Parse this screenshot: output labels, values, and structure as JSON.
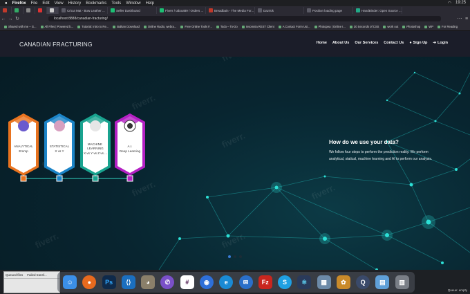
{
  "menubar": {
    "items": [
      "Firefox",
      "File",
      "Edit",
      "View",
      "History",
      "Bookmarks",
      "Tools",
      "Window",
      "Help"
    ],
    "clock": "19:25"
  },
  "tabs": [
    {
      "label": ""
    },
    {
      "label": ""
    },
    {
      "label": ""
    },
    {
      "label": ""
    },
    {
      "label": ""
    },
    {
      "label": "Cricut Mat - Bow Leather ..."
    },
    {
      "label": "Seller Dashboard"
    },
    {
      "label": "Fiverr / tabout89 / Orders ..."
    },
    {
      "label": "Breadbain - The Media For..."
    },
    {
      "label": "Dazrick"
    },
    {
      "label": "Position loading page"
    },
    {
      "label": "HandBinder: Open Source ..."
    }
  ],
  "address": {
    "url": "localhost:8888/canadian-fracturing/"
  },
  "bookmarks": [
    "Shared with me – G...",
    "All Files | Powered b...",
    "Tutorial: Intro to Re...",
    "Balkan Download",
    "Online Radio, webra...",
    "Free Online Tools F...",
    "Todo – To-Do",
    "Insomnia REST Client",
    "A Contact Form Usi...",
    "Photopea | Online I...",
    "30 Seconds of CSS",
    "work out",
    "Photoshop",
    "WP",
    "For Reading"
  ],
  "site": {
    "logo": "CANADIAN FRACTURING",
    "nav": [
      "Home",
      "About Us",
      "Our Services",
      "Contact Us",
      "Sign Up",
      "Login"
    ],
    "watermark": "fiverr.",
    "steps": [
      {
        "title": "ANALYTICAL",
        "subtitle": "Emmp",
        "color": "#e8731f"
      },
      {
        "title": "STATISTICAL",
        "subtitle": "X vs Y",
        "color": "#1b84c8"
      },
      {
        "title": "MACHINE LEARNING",
        "subtitle": "X vs Y vs Z vs ...",
        "color": "#19a38f"
      },
      {
        "title": "A.I.",
        "subtitle": "Deep Learning",
        "color": "#b421c4"
      }
    ],
    "info": {
      "heading": "How do we use your data?",
      "body": "We follow four steps to perform the prediction reality. We perform analytical, statical, machine learning and AI to perform our analysis."
    },
    "carousel": {
      "count": 3,
      "active_index": 0
    }
  },
  "ftp": {
    "col1": "Queued files",
    "col2": "Failed transf..."
  },
  "dock": {
    "apps": [
      {
        "name": "finder",
        "glyph": "☺",
        "color": "#3b8fe8"
      },
      {
        "name": "firefox",
        "glyph": "●",
        "color": "#e86a1e"
      },
      {
        "name": "photoshop",
        "glyph": "Ps",
        "color": "#0f2a4a"
      },
      {
        "name": "vscode",
        "glyph": "⟨⟩",
        "color": "#1b6fbf"
      },
      {
        "name": "gimp",
        "glyph": "◕",
        "color": "#8a7f6a"
      },
      {
        "name": "viber",
        "glyph": "✆",
        "color": "#7a50c8"
      },
      {
        "name": "slack",
        "glyph": "#",
        "color": "#ffffff"
      },
      {
        "name": "maps",
        "glyph": "◉",
        "color": "#2e6fd8"
      },
      {
        "name": "edge",
        "glyph": "e",
        "color": "#1a8ad4"
      },
      {
        "name": "thunderbird",
        "glyph": "✉",
        "color": "#2a6fc9"
      },
      {
        "name": "filezilla",
        "glyph": "Fz",
        "color": "#c9261e"
      },
      {
        "name": "skype",
        "glyph": "S",
        "color": "#1fa0e3"
      },
      {
        "name": "react-studio",
        "glyph": "⚛",
        "color": "#2a3a5a"
      },
      {
        "name": "preview",
        "glyph": "▦",
        "color": "#6c8aa8"
      },
      {
        "name": "game",
        "glyph": "✿",
        "color": "#c98a2a"
      },
      {
        "name": "quicktime",
        "glyph": "Q",
        "color": "#3a4a6a"
      },
      {
        "name": "downloads-folder",
        "glyph": "▤",
        "color": "#5fa0d8"
      },
      {
        "name": "trash",
        "glyph": "▥",
        "color": "#7a7f87"
      }
    ]
  },
  "status": {
    "queue": "Queue: empty"
  }
}
